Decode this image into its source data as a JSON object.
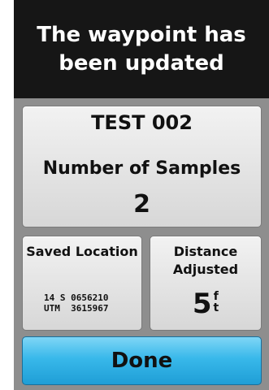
{
  "banner": {
    "message": "The waypoint has been updated"
  },
  "waypoint": {
    "name": "TEST 002",
    "samples_label": "Number of Samples",
    "samples_value": "2"
  },
  "saved_location": {
    "title": "Saved Location",
    "line1": "14 S 0656210",
    "line2": "UTM  3615967"
  },
  "distance": {
    "title": "Distance Adjusted",
    "value": "5",
    "unit_top": "f",
    "unit_bottom": "t"
  },
  "done_button": {
    "label": "Done"
  }
}
